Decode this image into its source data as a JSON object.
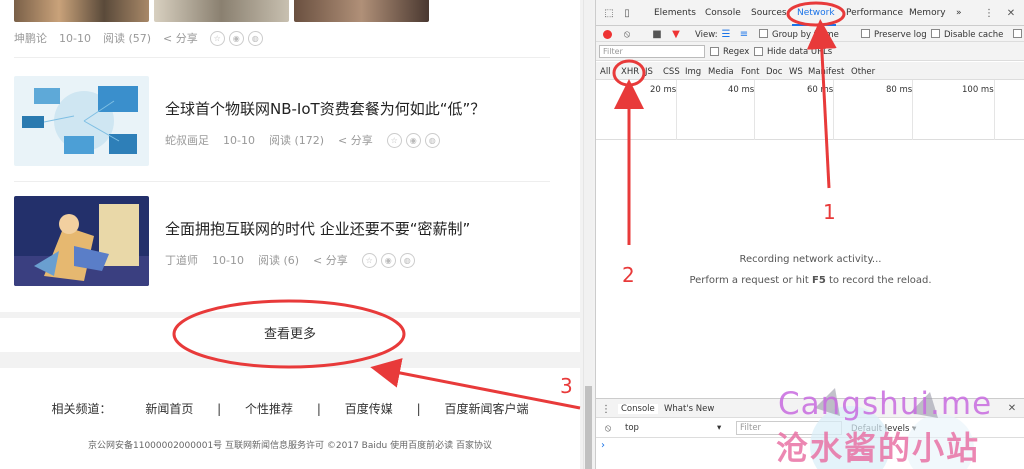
{
  "feed": {
    "top_item": {
      "author": "坤鹏论",
      "date": "10-10",
      "reads": "阅读 (57)",
      "share": "分享"
    },
    "items": [
      {
        "title": "全球首个物联网NB-IoT资费套餐为何如此“低”？",
        "author": "蛇叔画足",
        "date": "10-10",
        "reads": "阅读 (172)",
        "share": "分享"
      },
      {
        "title": "全面拥抱互联网的时代 企业还要不要“密薪制”",
        "author": "丁道师",
        "date": "10-10",
        "reads": "阅读 (6)",
        "share": "分享"
      }
    ],
    "more_label": "查看更多"
  },
  "footer": {
    "nav_label": "相关频道：",
    "links": [
      "新闻首页",
      "个性推荐",
      "百度传媒",
      "百度新闻客户端"
    ],
    "separator": "|",
    "copyright": "京公网安备11000002000001号 互联网新闻信息服务许可  ©2017  Baidu  使用百度前必读  百家协议"
  },
  "devtools": {
    "tabs": [
      "Elements",
      "Console",
      "Sources",
      "Network",
      "Performance",
      "Memory",
      "»"
    ],
    "active_tab": "Network",
    "toolbar": {
      "view_label": "View:",
      "group_by_frame": "Group by frame",
      "preserve_log": "Preserve log",
      "disable_cache": "Disable cache"
    },
    "filter": {
      "placeholder": "Filter",
      "regex": "Regex",
      "hide_data_urls": "Hide data URLs"
    },
    "types": [
      "All",
      "XHR",
      "JS",
      "CSS",
      "Img",
      "Media",
      "Font",
      "Doc",
      "WS",
      "Manifest",
      "Other"
    ],
    "timeline_ticks": [
      "20 ms",
      "40 ms",
      "60 ms",
      "80 ms",
      "100 ms"
    ],
    "empty_line1": "Recording network activity...",
    "empty_line2_a": "Perform a request or hit",
    "empty_line2_key": "F5",
    "empty_line2_b": "to record the reload.",
    "drawer_tabs": [
      "Console",
      "What's New"
    ],
    "console_context": "top",
    "console_filter": "Filter",
    "console_levels": "Default levels ▾",
    "prompt": "›"
  },
  "annotations": {
    "labels": [
      "1",
      "2",
      "3"
    ],
    "color": "#e83a3a"
  },
  "watermark": {
    "line1": "Cangshui.me",
    "line2": "沧水酱的小站"
  }
}
